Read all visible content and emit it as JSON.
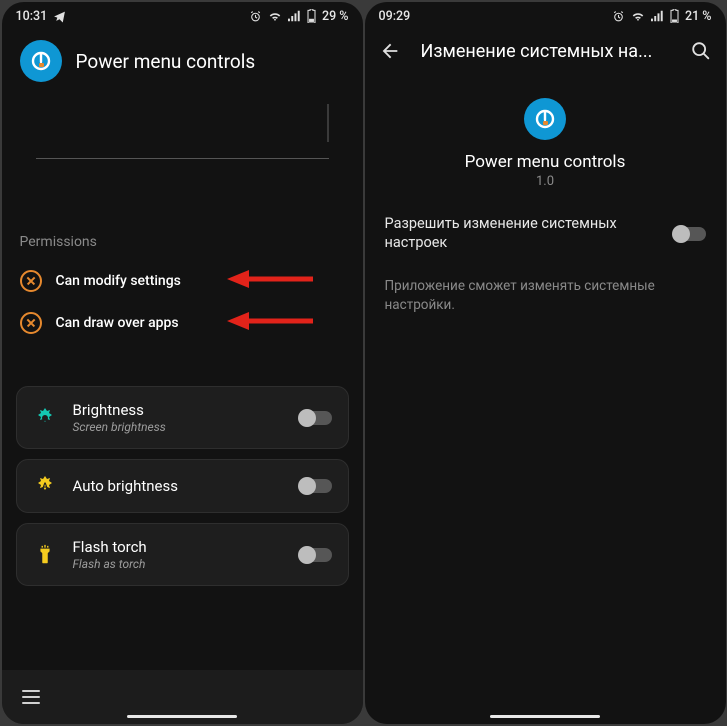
{
  "screen1": {
    "status": {
      "time": "10:31",
      "battery": "29 %"
    },
    "app_title": "Power menu controls",
    "permissions_heading": "Permissions",
    "permissions": [
      {
        "label": "Can modify settings"
      },
      {
        "label": "Can draw over apps"
      }
    ],
    "controls": [
      {
        "title": "Brightness",
        "subtitle": "Screen brightness",
        "icon": "brightness",
        "accent": "#14c9b3"
      },
      {
        "title": "Auto brightness",
        "subtitle": "",
        "icon": "auto",
        "accent": "#f5cc1f"
      },
      {
        "title": "Flash torch",
        "subtitle": "Flash as torch",
        "icon": "torch",
        "accent": "#f5cc1f"
      }
    ]
  },
  "screen2": {
    "status": {
      "time": "09:29",
      "battery": "21 %"
    },
    "page_title": "Изменение системных на...",
    "app_name": "Power menu controls",
    "app_version": "1.0",
    "setting_label": "Разрешить изменение системных настроек",
    "description": "Приложение сможет изменять системные настройки."
  }
}
